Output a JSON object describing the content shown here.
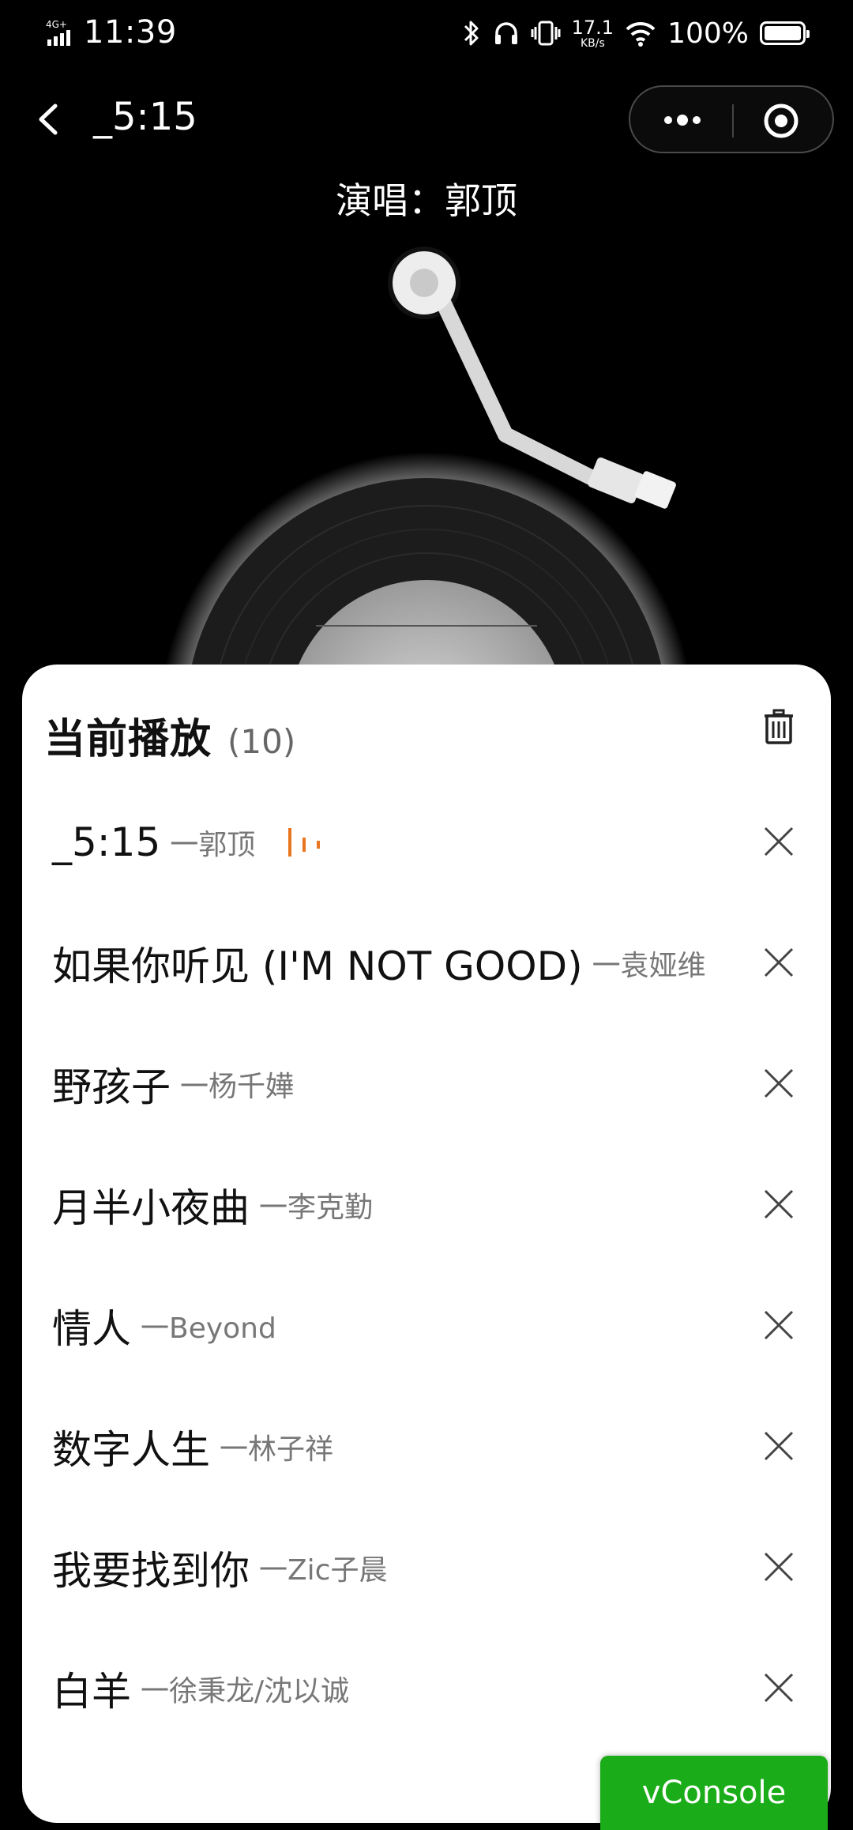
{
  "status_bar": {
    "network_icon": "4g-signal-icon",
    "time": "11:39",
    "speed_value": "17.1",
    "speed_unit": "KB/s",
    "battery": "100%"
  },
  "nav": {
    "title": "_5:15"
  },
  "player": {
    "singer_line": "演唱：郭顶"
  },
  "playlist": {
    "title": "当前播放",
    "count": "(10)",
    "accent_color": "#e8761f",
    "items": [
      {
        "song": "_5:15",
        "artist": "一郭顶",
        "playing": true
      },
      {
        "song": "如果你听见 (I'M NOT GOOD)",
        "artist": "一袁娅维",
        "playing": false
      },
      {
        "song": "野孩子",
        "artist": "一杨千嬅",
        "playing": false
      },
      {
        "song": "月半小夜曲",
        "artist": "一李克勤",
        "playing": false
      },
      {
        "song": "情人",
        "artist": "一Beyond",
        "playing": false
      },
      {
        "song": "数字人生",
        "artist": "一林子祥",
        "playing": false
      },
      {
        "song": "我要找到你",
        "artist": "一Zic子晨",
        "playing": false
      },
      {
        "song": "白羊",
        "artist": "一徐秉龙/沈以诚",
        "playing": false
      }
    ]
  },
  "vconsole": {
    "label": "vConsole",
    "color": "#1aad19"
  }
}
